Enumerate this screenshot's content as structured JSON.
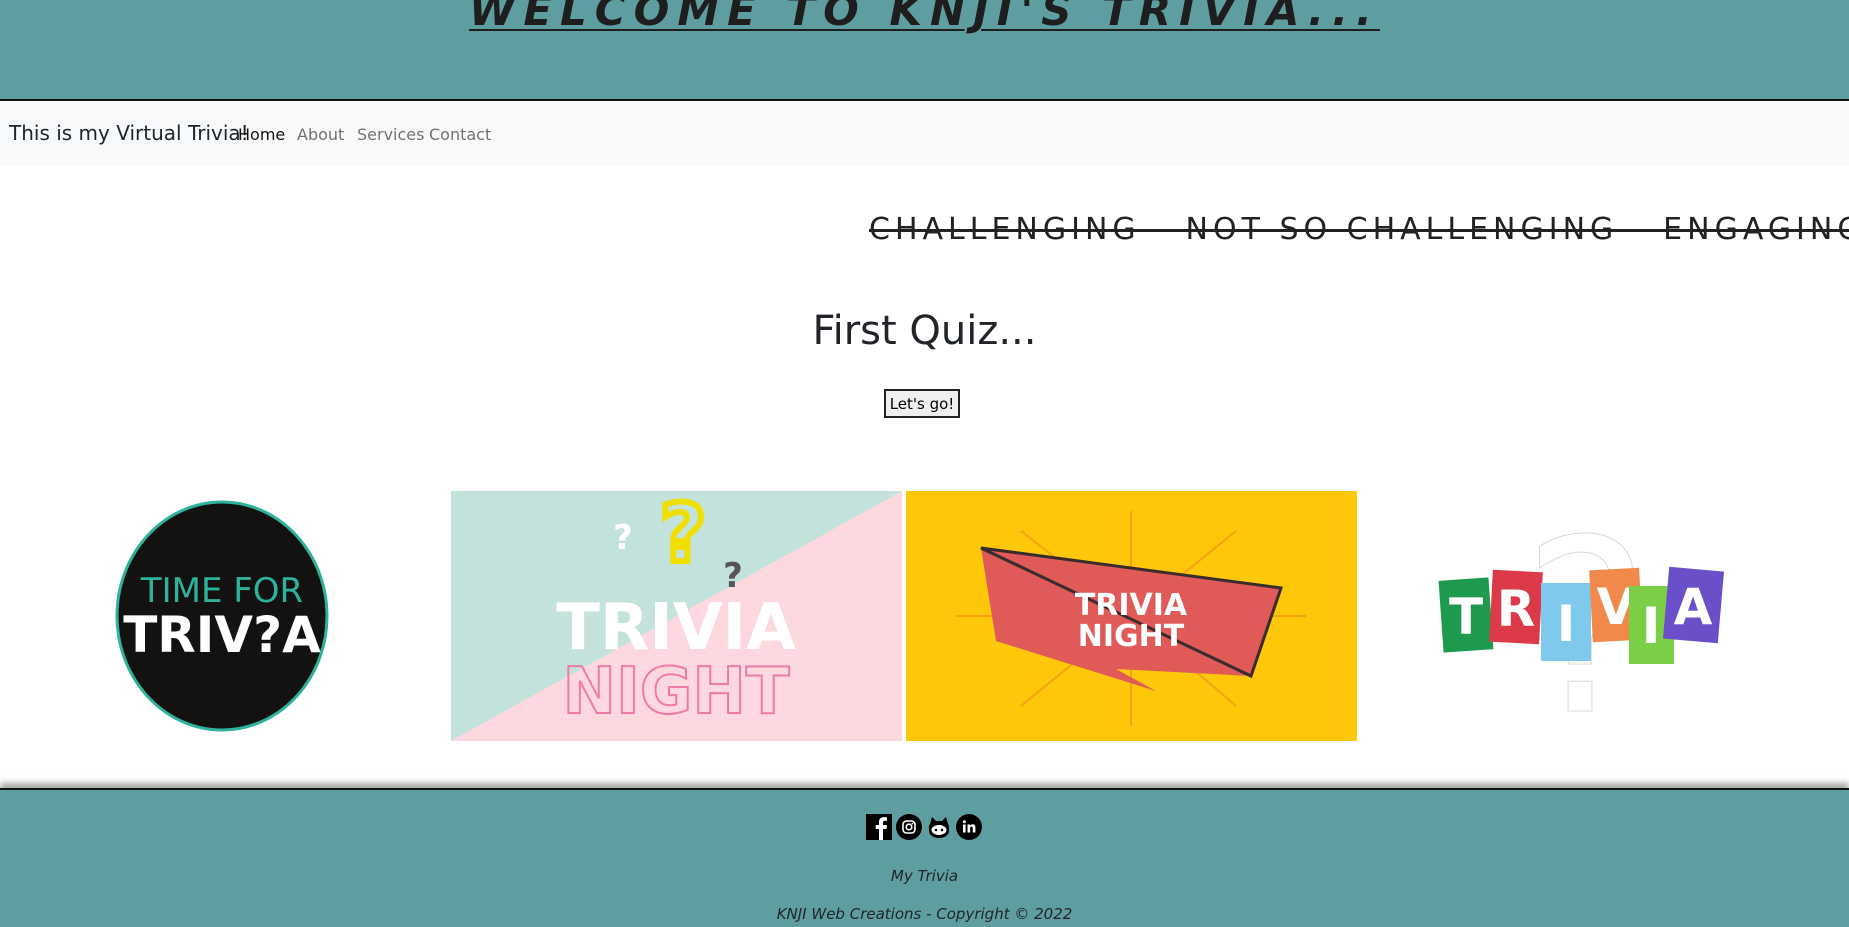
{
  "header": {
    "title": "WELCOME TO KNJI'S TRIVIA..."
  },
  "nav": {
    "brand": "This is my Virtual Trivia!",
    "links": [
      "Home",
      "About",
      "Services",
      "Contact"
    ],
    "active": "Home"
  },
  "hero": {
    "tagline": "CHALLENGING - NOT SO CHALLENGING - ENGAGING",
    "quiz_title": "First Quiz...",
    "button_label": "Let's go!"
  },
  "gallery": [
    {
      "name": "time-for-trivia-image",
      "line1": "TIME FOR",
      "line2": "TRIV?A"
    },
    {
      "name": "trivia-night-pastel-image",
      "line1": "TRIVIA",
      "line2": "NIGHT"
    },
    {
      "name": "trivia-night-yellow-image",
      "line1": "TRIVIA",
      "line2": "NIGHT"
    },
    {
      "name": "trivia-colorful-image",
      "letters": [
        "T",
        "R",
        "I",
        "V",
        "I",
        "A"
      ]
    }
  ],
  "footer": {
    "social_icons": [
      "facebook-icon",
      "instagram-icon",
      "github-icon",
      "linkedin-icon"
    ],
    "site_name": "My Trivia",
    "copyright": "KNJI Web Creations - Copyright © 2022"
  },
  "colors": {
    "header_bg": "#5f9ea0",
    "nav_bg": "#f8f9fa",
    "footer_bg": "#5f9ea0",
    "accent_teal": "#2db39c"
  }
}
